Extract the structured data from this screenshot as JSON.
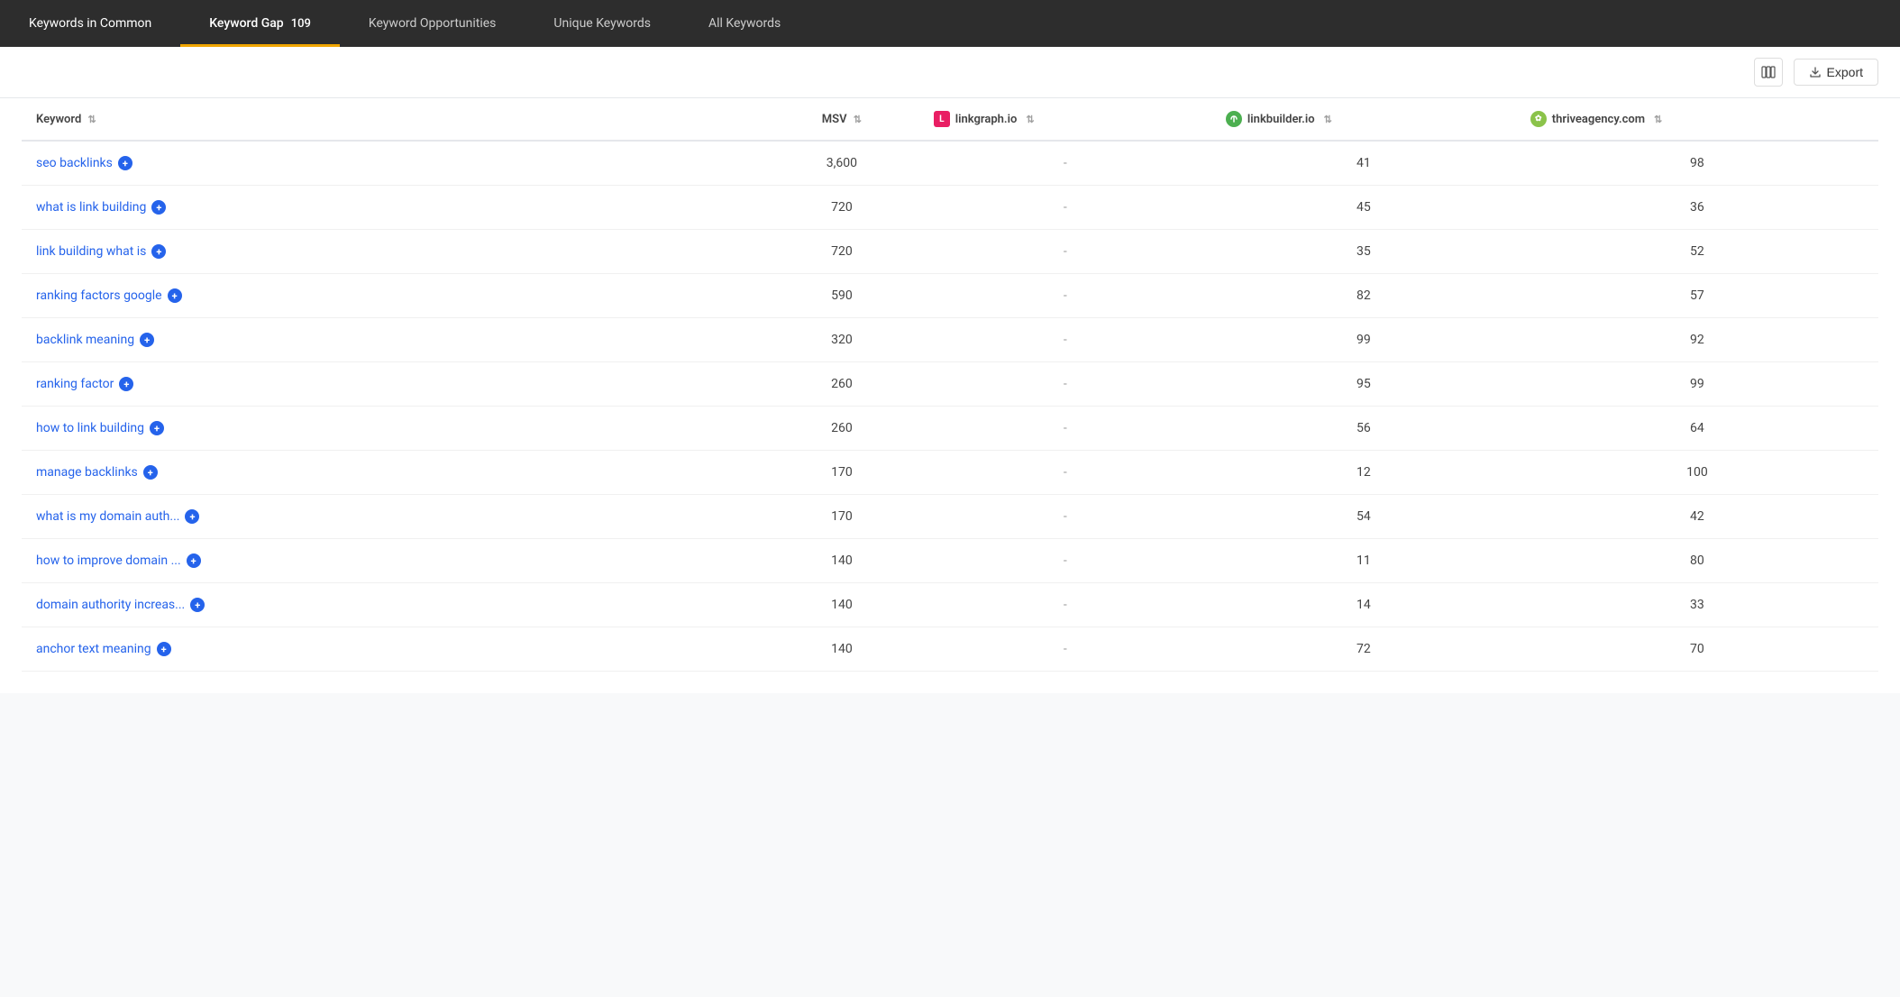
{
  "tabs": [
    {
      "id": "keywords-in-common",
      "label": "Keywords in Common",
      "badge": "",
      "active": false
    },
    {
      "id": "keyword-gap",
      "label": "Keyword Gap",
      "badge": "109",
      "active": true
    },
    {
      "id": "keyword-opportunities",
      "label": "Keyword Opportunities",
      "badge": "",
      "active": false
    },
    {
      "id": "unique-keywords",
      "label": "Unique Keywords",
      "badge": "",
      "active": false
    },
    {
      "id": "all-keywords",
      "label": "All Keywords",
      "badge": "",
      "active": false
    }
  ],
  "toolbar": {
    "columns_icon_title": "Columns",
    "export_label": "Export"
  },
  "table": {
    "columns": [
      {
        "id": "keyword",
        "label": "Keyword",
        "sortable": true
      },
      {
        "id": "msv",
        "label": "MSV",
        "sortable": true
      },
      {
        "id": "linkgraph",
        "label": "linkgraph.io",
        "sortable": true,
        "icon": "linkgraph-icon"
      },
      {
        "id": "linkbuilder",
        "label": "linkbuilder.io",
        "sortable": true,
        "icon": "linkbuilder-icon"
      },
      {
        "id": "thrive",
        "label": "thriveagency.com",
        "sortable": true,
        "icon": "thrive-icon"
      }
    ],
    "rows": [
      {
        "keyword": "seo backlinks",
        "msv": "3,600",
        "linkgraph": "-",
        "linkbuilder": "41",
        "thrive": "98"
      },
      {
        "keyword": "what is link building",
        "msv": "720",
        "linkgraph": "-",
        "linkbuilder": "45",
        "thrive": "36"
      },
      {
        "keyword": "link building what is",
        "msv": "720",
        "linkgraph": "-",
        "linkbuilder": "35",
        "thrive": "52"
      },
      {
        "keyword": "ranking factors google",
        "msv": "590",
        "linkgraph": "-",
        "linkbuilder": "82",
        "thrive": "57"
      },
      {
        "keyword": "backlink meaning",
        "msv": "320",
        "linkgraph": "-",
        "linkbuilder": "99",
        "thrive": "92"
      },
      {
        "keyword": "ranking factor",
        "msv": "260",
        "linkgraph": "-",
        "linkbuilder": "95",
        "thrive": "99"
      },
      {
        "keyword": "how to link building",
        "msv": "260",
        "linkgraph": "-",
        "linkbuilder": "56",
        "thrive": "64"
      },
      {
        "keyword": "manage backlinks",
        "msv": "170",
        "linkgraph": "-",
        "linkbuilder": "12",
        "thrive": "100"
      },
      {
        "keyword": "what is my domain auth...",
        "msv": "170",
        "linkgraph": "-",
        "linkbuilder": "54",
        "thrive": "42"
      },
      {
        "keyword": "how to improve domain ...",
        "msv": "140",
        "linkgraph": "-",
        "linkbuilder": "11",
        "thrive": "80"
      },
      {
        "keyword": "domain authority increas...",
        "msv": "140",
        "linkgraph": "-",
        "linkbuilder": "14",
        "thrive": "33"
      },
      {
        "keyword": "anchor text meaning",
        "msv": "140",
        "linkgraph": "-",
        "linkbuilder": "72",
        "thrive": "70"
      }
    ]
  }
}
